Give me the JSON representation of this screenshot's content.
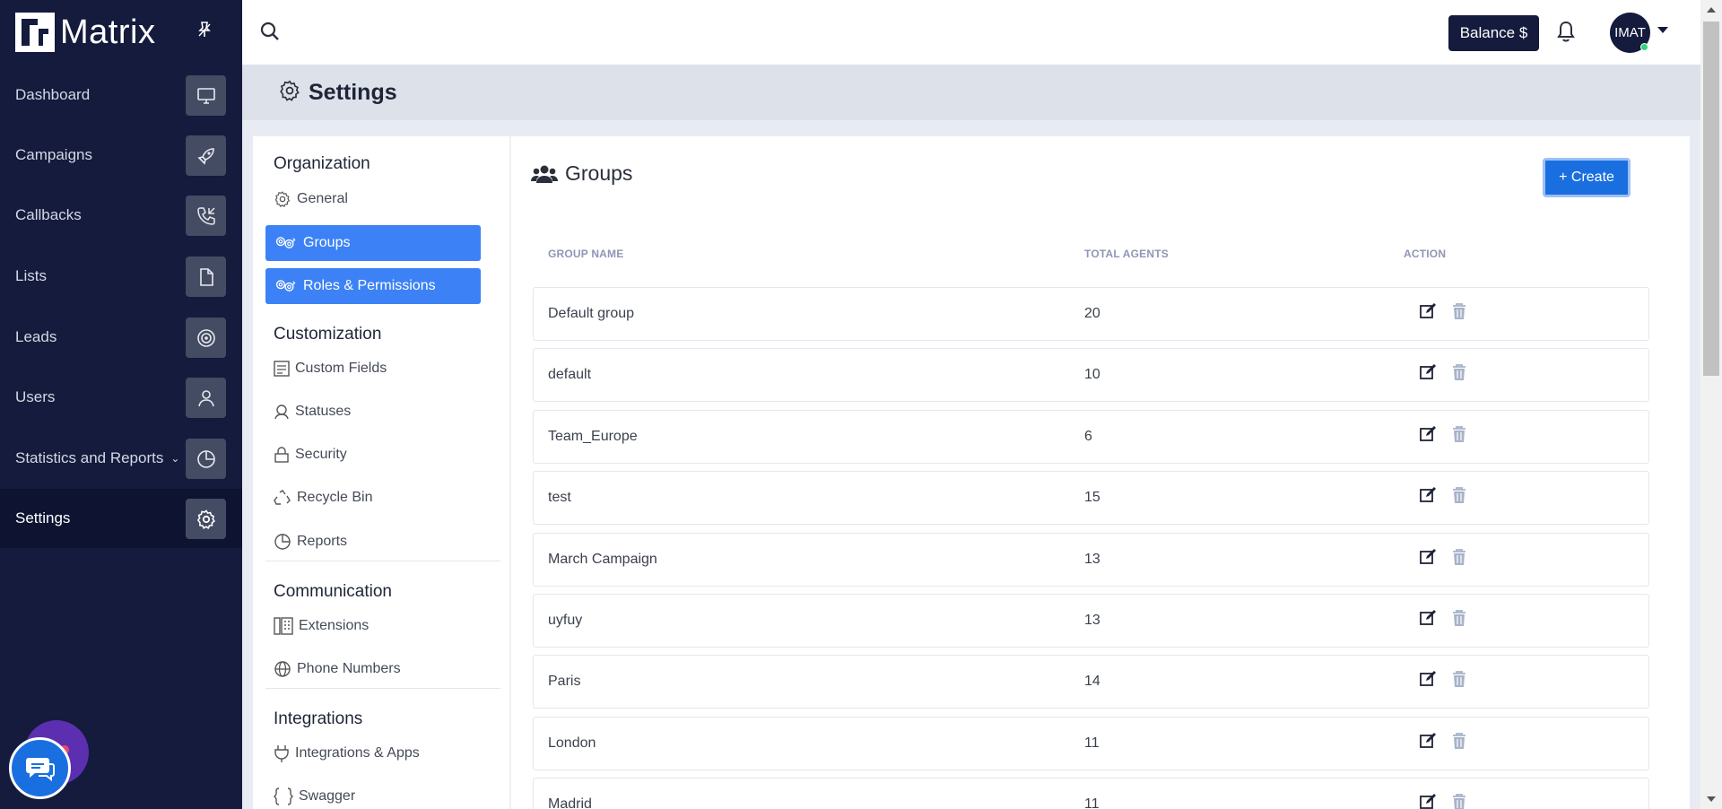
{
  "app": {
    "name": "Matrix"
  },
  "sidebar": {
    "items": [
      {
        "label": "Dashboard",
        "icon": "monitor-icon"
      },
      {
        "label": "Campaigns",
        "icon": "rocket-icon"
      },
      {
        "label": "Callbacks",
        "icon": "phone-callback-icon"
      },
      {
        "label": "Lists",
        "icon": "file-icon"
      },
      {
        "label": "Leads",
        "icon": "target-icon"
      },
      {
        "label": "Users",
        "icon": "user-icon"
      },
      {
        "label": "Statistics and Reports",
        "icon": "pie-chart-icon"
      },
      {
        "label": "Settings",
        "icon": "gear-icon",
        "active": true
      }
    ]
  },
  "topbar": {
    "balance_label": "Balance $",
    "avatar_initials": "IMAT"
  },
  "page": {
    "title": "Settings"
  },
  "subnav": {
    "organization": {
      "title": "Organization",
      "items": [
        {
          "label": "General"
        },
        {
          "label": "Groups",
          "active": true
        },
        {
          "label": "Roles & Permissions",
          "active": true
        }
      ]
    },
    "customization": {
      "title": "Customization",
      "items": [
        {
          "label": "Custom Fields"
        },
        {
          "label": "Statuses"
        },
        {
          "label": "Security"
        },
        {
          "label": "Recycle Bin"
        },
        {
          "label": "Reports"
        }
      ]
    },
    "communication": {
      "title": "Communication",
      "items": [
        {
          "label": "Extensions"
        },
        {
          "label": "Phone Numbers"
        }
      ]
    },
    "integrations": {
      "title": "Integrations",
      "items": [
        {
          "label": "Integrations & Apps"
        },
        {
          "label": "Swagger"
        }
      ]
    }
  },
  "groups": {
    "title": "Groups",
    "create_label": "+ Create",
    "columns": [
      "GROUP NAME",
      "TOTAL AGENTS",
      "ACTION"
    ],
    "rows": [
      {
        "name": "Default group",
        "agents": "20"
      },
      {
        "name": "default",
        "agents": "10"
      },
      {
        "name": "Team_Europe",
        "agents": "6"
      },
      {
        "name": "test",
        "agents": "15"
      },
      {
        "name": "March Campaign",
        "agents": "13"
      },
      {
        "name": "uyfuy",
        "agents": "13"
      },
      {
        "name": "Paris",
        "agents": "14"
      },
      {
        "name": "London",
        "agents": "11"
      },
      {
        "name": "Madrid",
        "agents": "11"
      }
    ]
  },
  "colors": {
    "sidebar_bg": "#141b3c",
    "accent": "#3c82f6",
    "create_button": "#1a6fe0"
  }
}
